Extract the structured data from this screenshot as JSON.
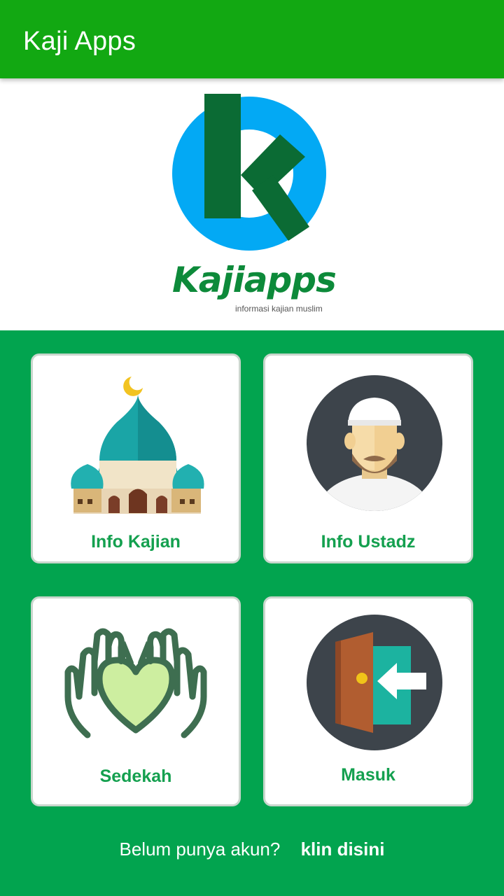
{
  "appbar": {
    "title": "Kaji Apps",
    "color": "#12a812"
  },
  "logo": {
    "wordmark": "Kajiapps",
    "tagline": "informasi kajian muslim",
    "circle_color": "#03a9f4",
    "letter_color": "#0b6b34"
  },
  "menu": [
    {
      "label": "Info Kajian",
      "icon": "mosque-icon"
    },
    {
      "label": "Info Ustadz",
      "icon": "ustadz-avatar-icon"
    },
    {
      "label": "Sedekah",
      "icon": "charity-hands-heart-icon"
    },
    {
      "label": "Masuk",
      "icon": "login-door-icon"
    }
  ],
  "footer": {
    "question": "Belum punya akun?",
    "link": "klin disini"
  },
  "colors": {
    "background": "#02a44f",
    "label_green": "#14a04f"
  }
}
